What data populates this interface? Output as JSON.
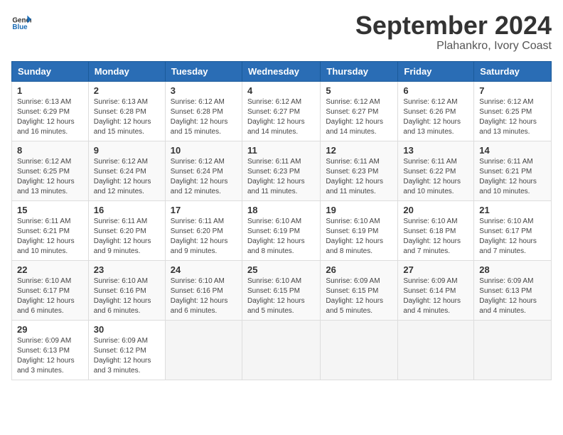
{
  "header": {
    "logo_line1": "General",
    "logo_line2": "Blue",
    "month": "September 2024",
    "location": "Plahankro, Ivory Coast"
  },
  "weekdays": [
    "Sunday",
    "Monday",
    "Tuesday",
    "Wednesday",
    "Thursday",
    "Friday",
    "Saturday"
  ],
  "weeks": [
    [
      {
        "day": "1",
        "sunrise": "6:13 AM",
        "sunset": "6:29 PM",
        "daylight": "12 hours and 16 minutes."
      },
      {
        "day": "2",
        "sunrise": "6:13 AM",
        "sunset": "6:28 PM",
        "daylight": "12 hours and 15 minutes."
      },
      {
        "day": "3",
        "sunrise": "6:12 AM",
        "sunset": "6:28 PM",
        "daylight": "12 hours and 15 minutes."
      },
      {
        "day": "4",
        "sunrise": "6:12 AM",
        "sunset": "6:27 PM",
        "daylight": "12 hours and 14 minutes."
      },
      {
        "day": "5",
        "sunrise": "6:12 AM",
        "sunset": "6:27 PM",
        "daylight": "12 hours and 14 minutes."
      },
      {
        "day": "6",
        "sunrise": "6:12 AM",
        "sunset": "6:26 PM",
        "daylight": "12 hours and 13 minutes."
      },
      {
        "day": "7",
        "sunrise": "6:12 AM",
        "sunset": "6:25 PM",
        "daylight": "12 hours and 13 minutes."
      }
    ],
    [
      {
        "day": "8",
        "sunrise": "6:12 AM",
        "sunset": "6:25 PM",
        "daylight": "12 hours and 13 minutes."
      },
      {
        "day": "9",
        "sunrise": "6:12 AM",
        "sunset": "6:24 PM",
        "daylight": "12 hours and 12 minutes."
      },
      {
        "day": "10",
        "sunrise": "6:12 AM",
        "sunset": "6:24 PM",
        "daylight": "12 hours and 12 minutes."
      },
      {
        "day": "11",
        "sunrise": "6:11 AM",
        "sunset": "6:23 PM",
        "daylight": "12 hours and 11 minutes."
      },
      {
        "day": "12",
        "sunrise": "6:11 AM",
        "sunset": "6:23 PM",
        "daylight": "12 hours and 11 minutes."
      },
      {
        "day": "13",
        "sunrise": "6:11 AM",
        "sunset": "6:22 PM",
        "daylight": "12 hours and 10 minutes."
      },
      {
        "day": "14",
        "sunrise": "6:11 AM",
        "sunset": "6:21 PM",
        "daylight": "12 hours and 10 minutes."
      }
    ],
    [
      {
        "day": "15",
        "sunrise": "6:11 AM",
        "sunset": "6:21 PM",
        "daylight": "12 hours and 10 minutes."
      },
      {
        "day": "16",
        "sunrise": "6:11 AM",
        "sunset": "6:20 PM",
        "daylight": "12 hours and 9 minutes."
      },
      {
        "day": "17",
        "sunrise": "6:11 AM",
        "sunset": "6:20 PM",
        "daylight": "12 hours and 9 minutes."
      },
      {
        "day": "18",
        "sunrise": "6:10 AM",
        "sunset": "6:19 PM",
        "daylight": "12 hours and 8 minutes."
      },
      {
        "day": "19",
        "sunrise": "6:10 AM",
        "sunset": "6:19 PM",
        "daylight": "12 hours and 8 minutes."
      },
      {
        "day": "20",
        "sunrise": "6:10 AM",
        "sunset": "6:18 PM",
        "daylight": "12 hours and 7 minutes."
      },
      {
        "day": "21",
        "sunrise": "6:10 AM",
        "sunset": "6:17 PM",
        "daylight": "12 hours and 7 minutes."
      }
    ],
    [
      {
        "day": "22",
        "sunrise": "6:10 AM",
        "sunset": "6:17 PM",
        "daylight": "12 hours and 6 minutes."
      },
      {
        "day": "23",
        "sunrise": "6:10 AM",
        "sunset": "6:16 PM",
        "daylight": "12 hours and 6 minutes."
      },
      {
        "day": "24",
        "sunrise": "6:10 AM",
        "sunset": "6:16 PM",
        "daylight": "12 hours and 6 minutes."
      },
      {
        "day": "25",
        "sunrise": "6:10 AM",
        "sunset": "6:15 PM",
        "daylight": "12 hours and 5 minutes."
      },
      {
        "day": "26",
        "sunrise": "6:09 AM",
        "sunset": "6:15 PM",
        "daylight": "12 hours and 5 minutes."
      },
      {
        "day": "27",
        "sunrise": "6:09 AM",
        "sunset": "6:14 PM",
        "daylight": "12 hours and 4 minutes."
      },
      {
        "day": "28",
        "sunrise": "6:09 AM",
        "sunset": "6:13 PM",
        "daylight": "12 hours and 4 minutes."
      }
    ],
    [
      {
        "day": "29",
        "sunrise": "6:09 AM",
        "sunset": "6:13 PM",
        "daylight": "12 hours and 3 minutes."
      },
      {
        "day": "30",
        "sunrise": "6:09 AM",
        "sunset": "6:12 PM",
        "daylight": "12 hours and 3 minutes."
      },
      null,
      null,
      null,
      null,
      null
    ]
  ]
}
